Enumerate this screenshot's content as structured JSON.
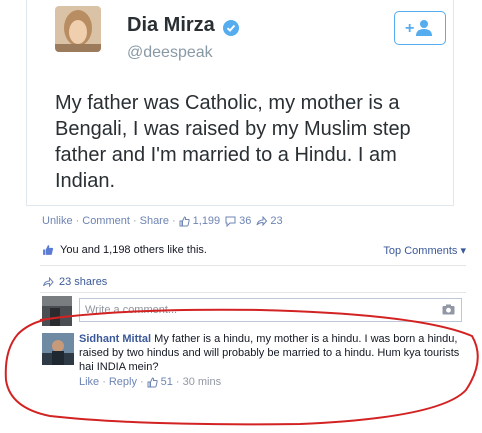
{
  "tweet": {
    "display_name": "Dia Mirza",
    "handle": "@deespeak",
    "text": "My father was Catholic, my mother is a Bengali, I was raised by my Muslim step father and I'm married to a Hindu. I am Indian.",
    "follow_icon": "follow-plus-user-icon"
  },
  "post_actions": {
    "unlike": "Unlike",
    "comment": "Comment",
    "share": "Share",
    "likes_count": "1,199",
    "comments_count": "36",
    "shares_count": "23"
  },
  "likes_summary": {
    "text": "You and 1,198 others like this.",
    "top_comments": "Top Comments"
  },
  "shares": {
    "text": "23 shares"
  },
  "composer": {
    "placeholder": "Write a comment..."
  },
  "comment": {
    "author": "Sidhant Mittal",
    "text": "My father is a hindu, my mother is a hindu. I was born a hindu, raised by two hindus and will probably be married to a hindu. Hum kya tourists hai INDIA mein?",
    "like": "Like",
    "reply": "Reply",
    "likes": "51",
    "time": "30 mins"
  },
  "colors": {
    "link": "#3b5998",
    "twitter_blue": "#55acee",
    "annotation_red": "#d32222"
  }
}
